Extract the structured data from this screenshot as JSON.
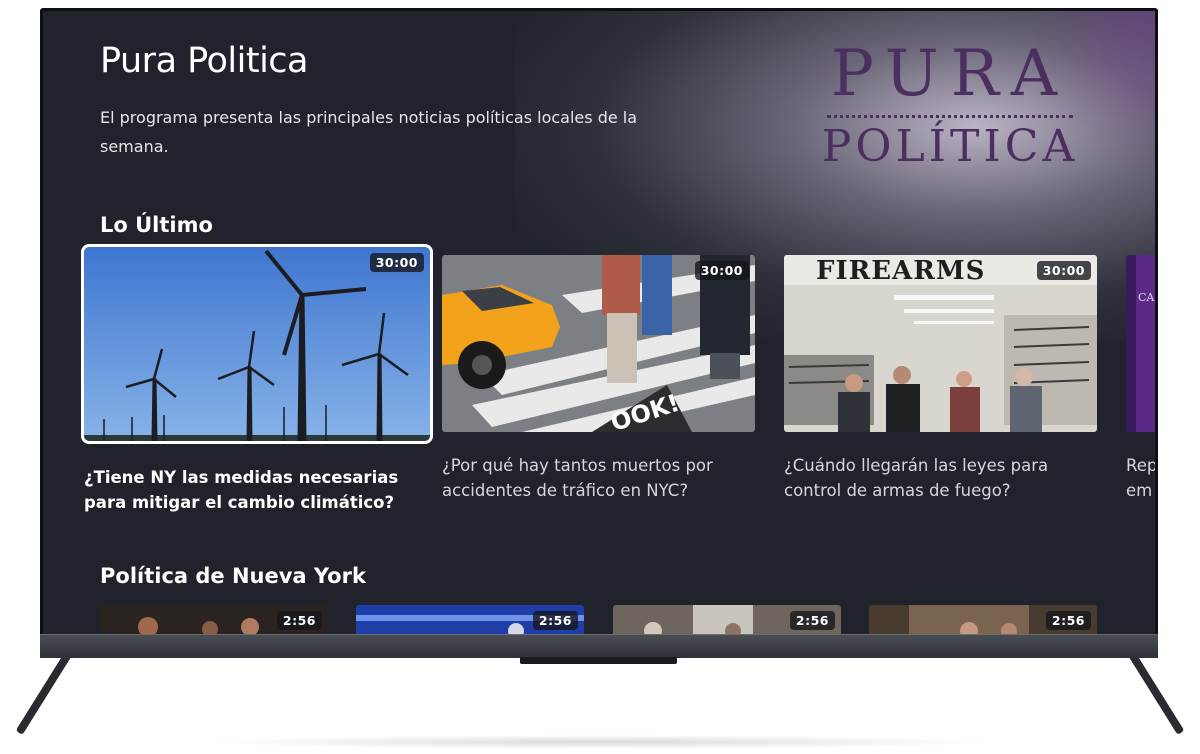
{
  "show": {
    "title": "Pura Politica",
    "description": "El programa presenta las principales noticias políticas locales de la semana.",
    "logo_line1": "PURA",
    "logo_line2": "POLÍTICA"
  },
  "sections": [
    {
      "title": "Lo Último",
      "items": [
        {
          "title": "¿Tiene NY las medidas necesarias para mitigar el cambio climático?",
          "duration": "30:00",
          "image": "wind-turbines"
        },
        {
          "title": "¿Por qué hay tantos muertos por accidentes de tráfico en NYC?",
          "duration": "30:00",
          "image": "crosswalk-taxi",
          "sign_text": "OOK!"
        },
        {
          "title": "¿Cuándo llegarán las leyes para control de armas de fuego?",
          "duration": "30:00",
          "image": "gun-store",
          "sign_text": "FIREARMS"
        },
        {
          "title": "Rep em",
          "image": "partial-card",
          "card_text": "CA TO"
        }
      ]
    },
    {
      "title": "Política de Nueva York",
      "items": [
        {
          "duration": "2:56"
        },
        {
          "duration": "2:56"
        },
        {
          "duration": "2:56"
        },
        {
          "duration": "2:56"
        }
      ]
    }
  ],
  "colors": {
    "screen_bg": "#20232b",
    "brand": "#4a2f5f",
    "focus_ring": "#ffffff"
  }
}
